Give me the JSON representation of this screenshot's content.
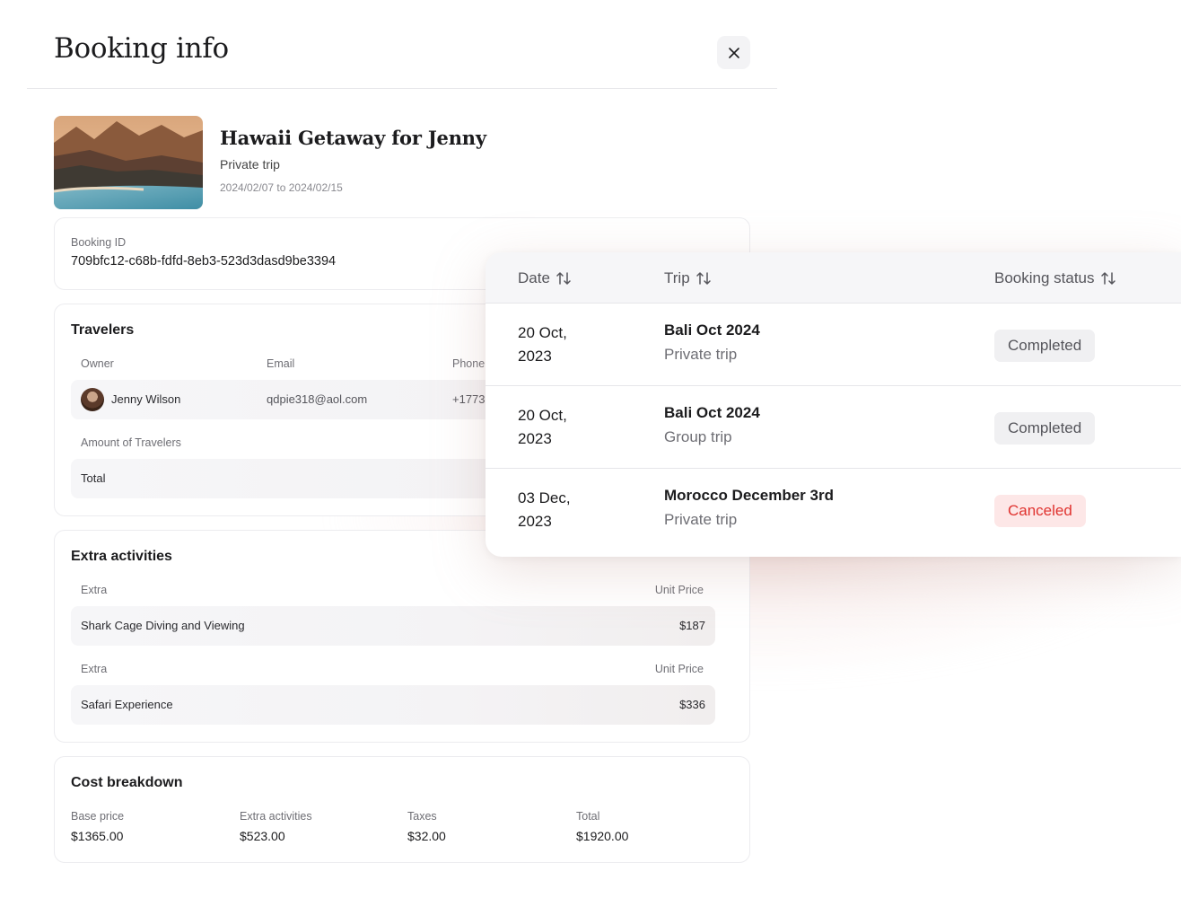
{
  "header": {
    "title": "Booking info"
  },
  "trip": {
    "title": "Hawaii Getaway for Jenny",
    "type": "Private trip",
    "dates": "2024/02/07 to 2024/02/15"
  },
  "booking": {
    "id_label": "Booking ID",
    "id_value": "709bfc12-c68b-fdfd-8eb3-523d3dasd9be3394"
  },
  "travelers": {
    "title": "Travelers",
    "columns": {
      "owner": "Owner",
      "email": "Email",
      "phone": "Phone"
    },
    "owner": {
      "name": "Jenny Wilson",
      "email": "qdpie318@aol.com",
      "phone": "+1773"
    },
    "amount_label": "Amount of Travelers",
    "total_label": "Total"
  },
  "extras": {
    "title": "Extra activities",
    "items": [
      {
        "col_extra": "Extra",
        "col_price": "Unit Price",
        "name": "Shark Cage Diving and Viewing",
        "price": "$187"
      },
      {
        "col_extra": "Extra",
        "col_price": "Unit Price",
        "name": "Safari Experience",
        "price": "$336"
      }
    ]
  },
  "cost": {
    "title": "Cost breakdown",
    "items": [
      {
        "label": "Base price",
        "value": "$1365.00"
      },
      {
        "label": "Extra activities",
        "value": "$523.00"
      },
      {
        "label": "Taxes",
        "value": "$32.00"
      },
      {
        "label": "Total",
        "value": "$1920.00"
      }
    ]
  },
  "bookings_table": {
    "columns": {
      "date": "Date",
      "trip": "Trip",
      "status": "Booking status"
    },
    "rows": [
      {
        "date": "20 Oct, 2023",
        "trip": "Bali Oct 2024",
        "type": "Private trip",
        "status": "Completed"
      },
      {
        "date": "20 Oct, 2023",
        "trip": "Bali Oct 2024",
        "type": "Group trip",
        "status": "Completed"
      },
      {
        "date": "03 Dec, 2023",
        "trip": "Morocco December 3rd",
        "type": "Private trip",
        "status": "Canceled"
      }
    ]
  },
  "colors": {
    "canceled_text": "#e0332f",
    "canceled_bg": "#fde7e7",
    "completed_bg": "#f0f0f2"
  }
}
